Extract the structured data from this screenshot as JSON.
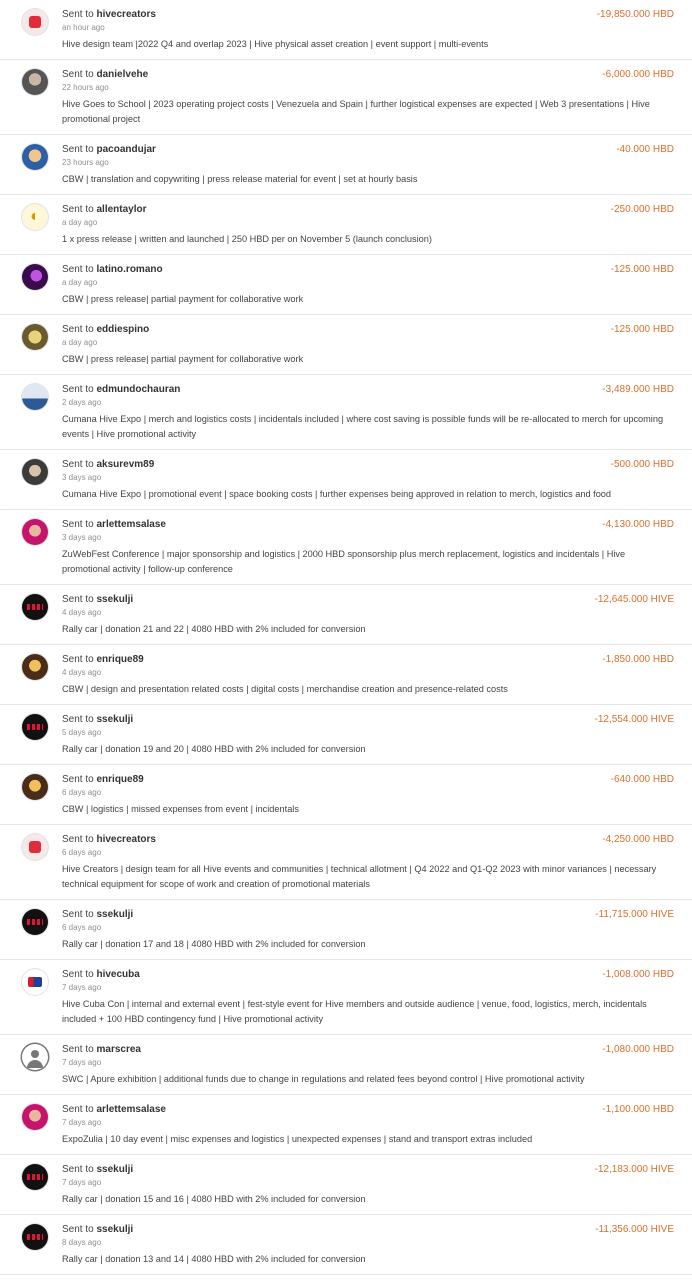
{
  "sent_prefix": "Sent to",
  "transfers": [
    {
      "avatar": "hivecreators",
      "to": "hivecreators",
      "time": "an hour ago",
      "amount": "-19,850.000 HBD",
      "memo": "Hive design team |2022 Q4 and overlap 2023 | Hive physical asset creation | event support | multi-events"
    },
    {
      "avatar": "danielvehe",
      "to": "danielvehe",
      "time": "22 hours ago",
      "amount": "-6,000.000 HBD",
      "memo": "Hive Goes to School | 2023 operating project costs | Venezuela and Spain | further logistical expenses are expected | Web 3 presentations | Hive promotional project"
    },
    {
      "avatar": "pacoandujar",
      "to": "pacoandujar",
      "time": "23 hours ago",
      "amount": "-40.000 HBD",
      "memo": "CBW | translation and copywriting | press release material for event | set at hourly basis"
    },
    {
      "avatar": "allentaylor",
      "to": "allentaylor",
      "time": "a day ago",
      "amount": "-250.000 HBD",
      "memo": "1 x press release | written and launched | 250 HBD per on November 5 (launch conclusion)"
    },
    {
      "avatar": "latino",
      "to": "latino.romano",
      "time": "a day ago",
      "amount": "-125.000 HBD",
      "memo": "CBW | press release| partial payment for collaborative work"
    },
    {
      "avatar": "eddie",
      "to": "eddiespino",
      "time": "a day ago",
      "amount": "-125.000 HBD",
      "memo": "CBW | press release| partial payment for collaborative work"
    },
    {
      "avatar": "edmundo",
      "to": "edmundochauran",
      "time": "2 days ago",
      "amount": "-3,489.000 HBD",
      "memo": "Cumana Hive Expo | merch and logistics costs | incidentals included | where cost saving is possible funds will be re-allocated to merch for upcoming events | Hive promotional activity"
    },
    {
      "avatar": "aksure",
      "to": "aksurevm89",
      "time": "3 days ago",
      "amount": "-500.000 HBD",
      "memo": "Cumana Hive Expo | promotional event | space booking costs | further expenses being approved in relation to merch, logistics and food"
    },
    {
      "avatar": "arlette",
      "to": "arlettemsalase",
      "time": "3 days ago",
      "amount": "-4,130.000 HBD",
      "memo": "ZuWebFest Conference | major sponsorship and logistics | 2000 HBD sponsorship plus merch replacement, logistics and incidentals | Hive promotional activity | follow-up conference"
    },
    {
      "avatar": "ssekulji",
      "to": "ssekulji",
      "time": "4 days ago",
      "amount": "-12,645.000 HIVE",
      "memo": "Rally car | donation 21 and 22 | 4080 HBD with 2% included for conversion"
    },
    {
      "avatar": "enrique",
      "to": "enrique89",
      "time": "4 days ago",
      "amount": "-1,850.000 HBD",
      "memo": "CBW | design and presentation related costs | digital costs | merchandise creation and presence-related costs"
    },
    {
      "avatar": "ssekulji",
      "to": "ssekulji",
      "time": "5 days ago",
      "amount": "-12,554.000 HIVE",
      "memo": "Rally car | donation 19 and 20 | 4080 HBD with 2% included for conversion"
    },
    {
      "avatar": "enrique",
      "to": "enrique89",
      "time": "6 days ago",
      "amount": "-640.000 HBD",
      "memo": "CBW | logistics | missed expenses from event | incidentals"
    },
    {
      "avatar": "hivecreators",
      "to": "hivecreators",
      "time": "6 days ago",
      "amount": "-4,250.000 HBD",
      "memo": "Hive Creators | design team for all Hive events and communities | technical allotment | Q4 2022 and Q1-Q2 2023 with minor variances | necessary technical equipment for scope of work and creation of promotional materials"
    },
    {
      "avatar": "ssekulji",
      "to": "ssekulji",
      "time": "6 days ago",
      "amount": "-11,715.000 HIVE",
      "memo": "Rally car | donation 17 and 18 | 4080 HBD with 2% included for conversion"
    },
    {
      "avatar": "hivecuba",
      "to": "hivecuba",
      "time": "7 days ago",
      "amount": "-1,008.000 HBD",
      "memo": "Hive Cuba Con | internal and external event | fest-style event for Hive members and outside audience | venue, food, logistics, merch, incidentals included + 100 HBD contingency fund | Hive promotional activity"
    },
    {
      "avatar": "default",
      "to": "marscrea",
      "time": "7 days ago",
      "amount": "-1,080.000 HBD",
      "memo": "SWC | Apure exhibition | additional funds due to change in regulations and related fees beyond control | Hive promotional activity"
    },
    {
      "avatar": "arlette",
      "to": "arlettemsalase",
      "time": "7 days ago",
      "amount": "-1,100.000 HBD",
      "memo": "ExpoZulia | 10 day event | misc expenses and logistics | unexpected expenses | stand and transport extras included"
    },
    {
      "avatar": "ssekulji",
      "to": "ssekulji",
      "time": "7 days ago",
      "amount": "-12,183.000 HIVE",
      "memo": "Rally car | donation 15 and 16 | 4080 HBD with 2% included for conversion"
    },
    {
      "avatar": "ssekulji",
      "to": "ssekulji",
      "time": "8 days ago",
      "amount": "-11,356.000 HIVE",
      "memo": "Rally car | donation 13 and 14 | 4080 HBD with 2% included for conversion"
    }
  ]
}
